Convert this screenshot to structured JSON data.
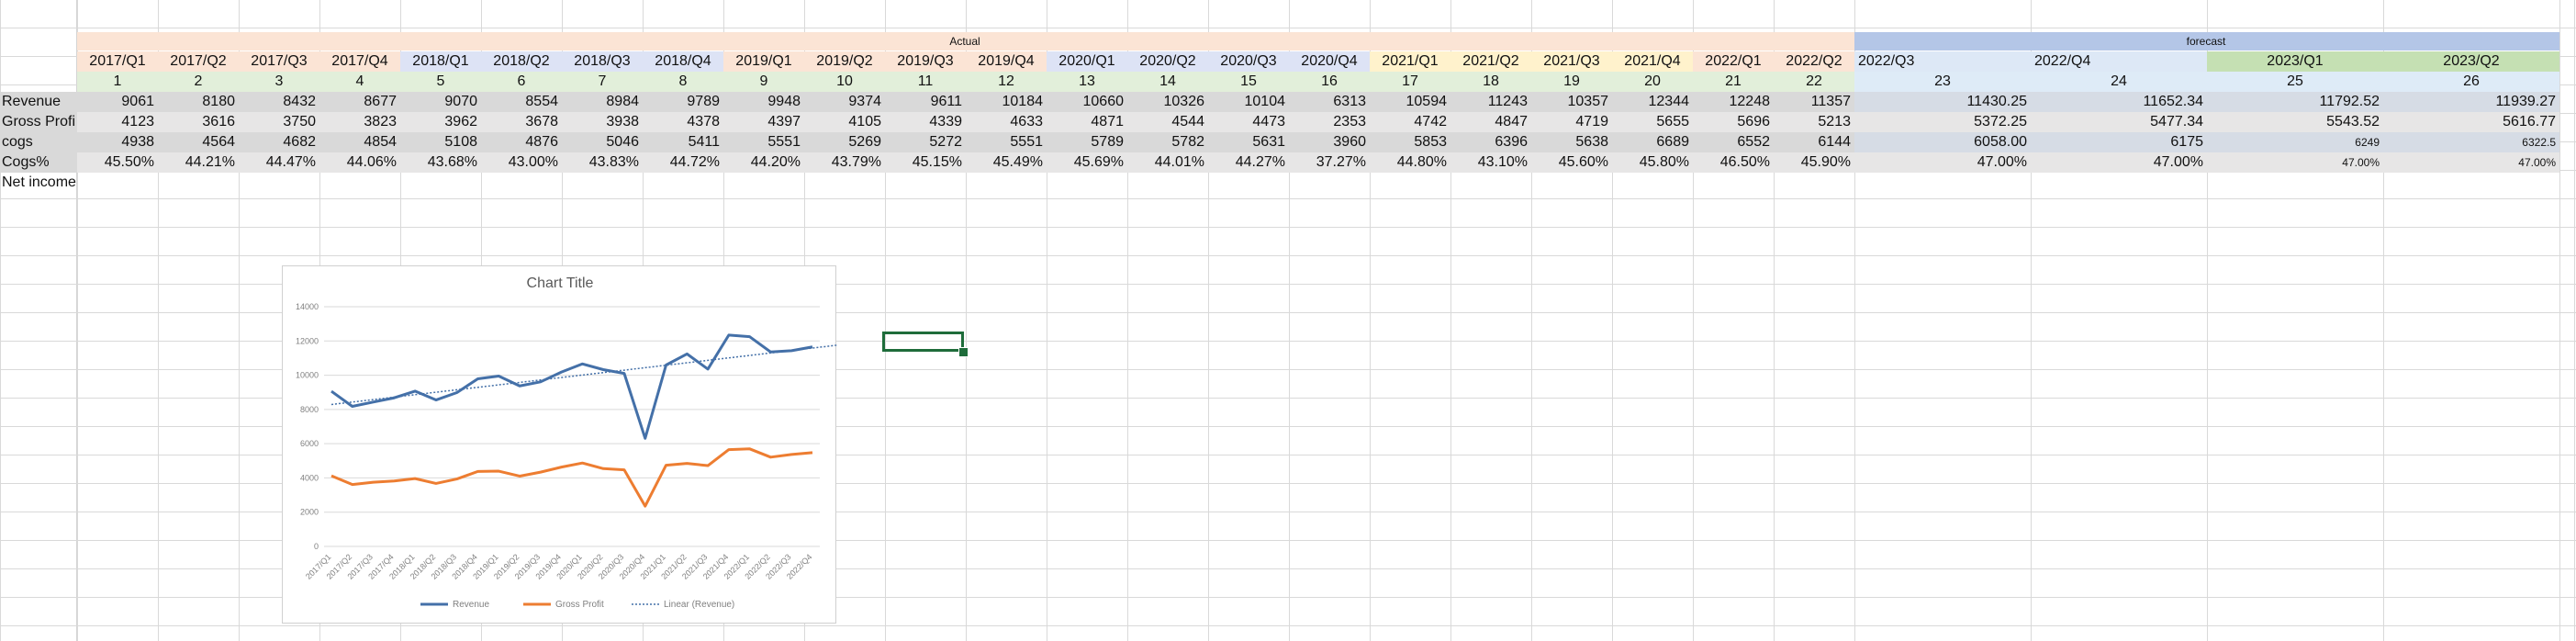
{
  "app": {
    "title": ""
  },
  "header_groups": {
    "actual": "Actual",
    "forecast": "forecast"
  },
  "periods": [
    "2017/Q1",
    "2017/Q2",
    "2017/Q3",
    "2017/Q4",
    "2018/Q1",
    "2018/Q2",
    "2018/Q3",
    "2018/Q4",
    "2019/Q1",
    "2019/Q2",
    "2019/Q3",
    "2019/Q4",
    "2020/Q1",
    "2020/Q2",
    "2020/Q3",
    "2020/Q4",
    "2021/Q1",
    "2021/Q2",
    "2021/Q3",
    "2021/Q4",
    "2022/Q1",
    "2022/Q2",
    "2022/Q3",
    "2022/Q4",
    "2023/Q1",
    "2023/Q2"
  ],
  "index": [
    "1",
    "2",
    "3",
    "4",
    "5",
    "6",
    "7",
    "8",
    "9",
    "10",
    "11",
    "12",
    "13",
    "14",
    "15",
    "16",
    "17",
    "18",
    "19",
    "20",
    "21",
    "22",
    "23",
    "24",
    "25",
    "26"
  ],
  "rows": [
    {
      "label": "Revenue",
      "values": [
        "9061",
        "8180",
        "8432",
        "8677",
        "9070",
        "8554",
        "8984",
        "9789",
        "9948",
        "9374",
        "9611",
        "10184",
        "10660",
        "10326",
        "10104",
        "6313",
        "10594",
        "11243",
        "10357",
        "12344",
        "12248",
        "11357",
        "11430.25",
        "11652.34",
        "11792.52",
        "11939.27"
      ]
    },
    {
      "label": "Gross Profi",
      "values": [
        "4123",
        "3616",
        "3750",
        "3823",
        "3962",
        "3678",
        "3938",
        "4378",
        "4397",
        "4105",
        "4339",
        "4633",
        "4871",
        "4544",
        "4473",
        "2353",
        "4742",
        "4847",
        "4719",
        "5655",
        "5696",
        "5213",
        "5372.25",
        "5477.34",
        "5543.52",
        "5616.77"
      ]
    },
    {
      "label": "cogs",
      "values": [
        "4938",
        "4564",
        "4682",
        "4854",
        "5108",
        "4876",
        "5046",
        "5411",
        "5551",
        "5269",
        "5272",
        "5551",
        "5789",
        "5782",
        "5631",
        "3960",
        "5853",
        "6396",
        "5638",
        "6689",
        "6552",
        "6144",
        "6058.00",
        "6175",
        "6249",
        "6322.5"
      ]
    },
    {
      "label": "Cogs%",
      "values": [
        "45.50%",
        "44.21%",
        "44.47%",
        "44.06%",
        "43.68%",
        "43.00%",
        "43.83%",
        "44.72%",
        "44.20%",
        "43.79%",
        "45.15%",
        "45.49%",
        "45.69%",
        "44.01%",
        "44.27%",
        "37.27%",
        "44.80%",
        "43.10%",
        "45.60%",
        "45.80%",
        "46.50%",
        "45.90%",
        "47.00%",
        "47.00%",
        "47.00%",
        "47.00%"
      ]
    },
    {
      "label": "Net income",
      "values": []
    }
  ],
  "colors": {
    "actual_band": "#fbe4d5",
    "forecast_band": "#b4c6e7",
    "revenue_line": "#4470a8",
    "gross_profit_line": "#ed7d31",
    "grid": "#d9d9d9",
    "selection": "#1e6c3a"
  },
  "chart_data": {
    "type": "line",
    "title": "Chart Title",
    "categories": [
      "2017/Q1",
      "2017/Q2",
      "2017/Q3",
      "2017/Q4",
      "2018/Q1",
      "2018/Q2",
      "2018/Q3",
      "2018/Q4",
      "2019/Q1",
      "2019/Q2",
      "2019/Q3",
      "2019/Q4",
      "2020/Q1",
      "2020/Q2",
      "2020/Q3",
      "2020/Q4",
      "2021/Q1",
      "2021/Q2",
      "2021/Q3",
      "2021/Q4",
      "2022/Q1",
      "2022/Q2",
      "2022/Q3",
      "2022/Q4"
    ],
    "series": [
      {
        "name": "Revenue",
        "values": [
          9061,
          8180,
          8432,
          8677,
          9070,
          8554,
          8984,
          9789,
          9948,
          9374,
          9611,
          10184,
          10660,
          10326,
          10104,
          6313,
          10594,
          11243,
          10357,
          12344,
          12248,
          11357,
          11430.25,
          11652.34
        ]
      },
      {
        "name": "Gross Profit",
        "values": [
          4123,
          3616,
          3750,
          3823,
          3962,
          3678,
          3938,
          4378,
          4397,
          4105,
          4339,
          4633,
          4871,
          4544,
          4473,
          2353,
          4742,
          4847,
          4719,
          5655,
          5696,
          5213,
          5372.25,
          5477.34
        ]
      }
    ],
    "trendline": {
      "name": "Linear (Revenue)",
      "of": "Revenue"
    },
    "ylim": [
      0,
      14000
    ],
    "yticks": [
      "0",
      "2000",
      "4000",
      "6000",
      "8000",
      "10000",
      "12000",
      "14000"
    ],
    "grid": true,
    "legend": "bottom"
  }
}
